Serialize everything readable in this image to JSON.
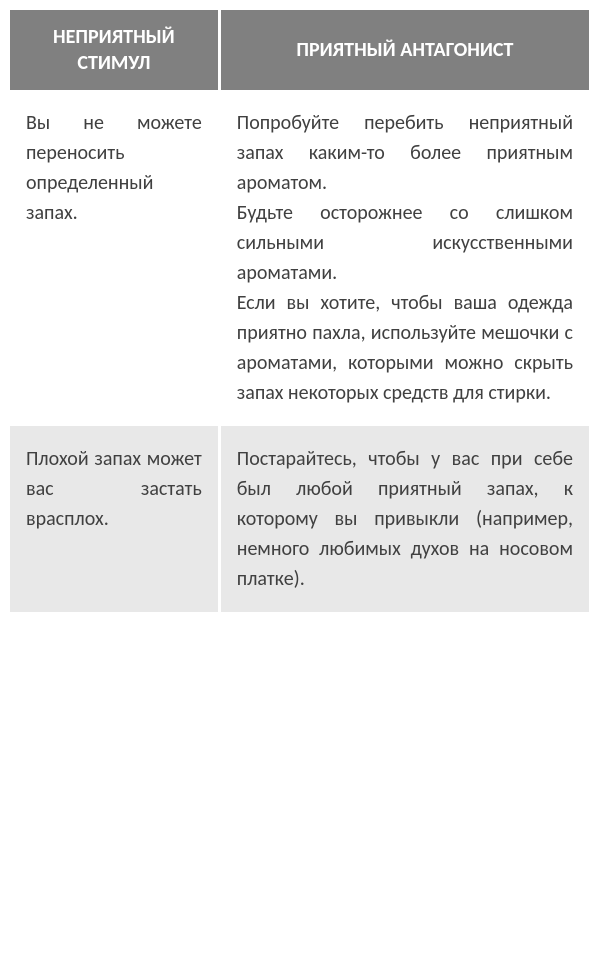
{
  "table": {
    "headers": {
      "col1": "НЕПРИЯТНЫЙ СТИМУЛ",
      "col2": "ПРИЯТНЫЙ АНТАГОНИСТ"
    },
    "rows": [
      {
        "col1": "Вы не можете переносить определенный запах.",
        "col2_p1": "Попробуйте перебить неприятный запах каким-то более приятным ароматом.",
        "col2_p2": "Будьте осторожнее со слишком сильными искусственными ароматами.",
        "col2_p3": "Если вы хотите, чтобы ваша одежда приятно пахла, используйте мешочки с ароматами, которыми можно скрыть запах некоторых средств для стирки."
      },
      {
        "col1": "Плохой запах может вас застать врасплох.",
        "col2": "Постарайтесь, чтобы у вас при себе был любой приятный запах, к которому вы привыкли (например, немного любимых духов на носовом платке)."
      }
    ]
  }
}
